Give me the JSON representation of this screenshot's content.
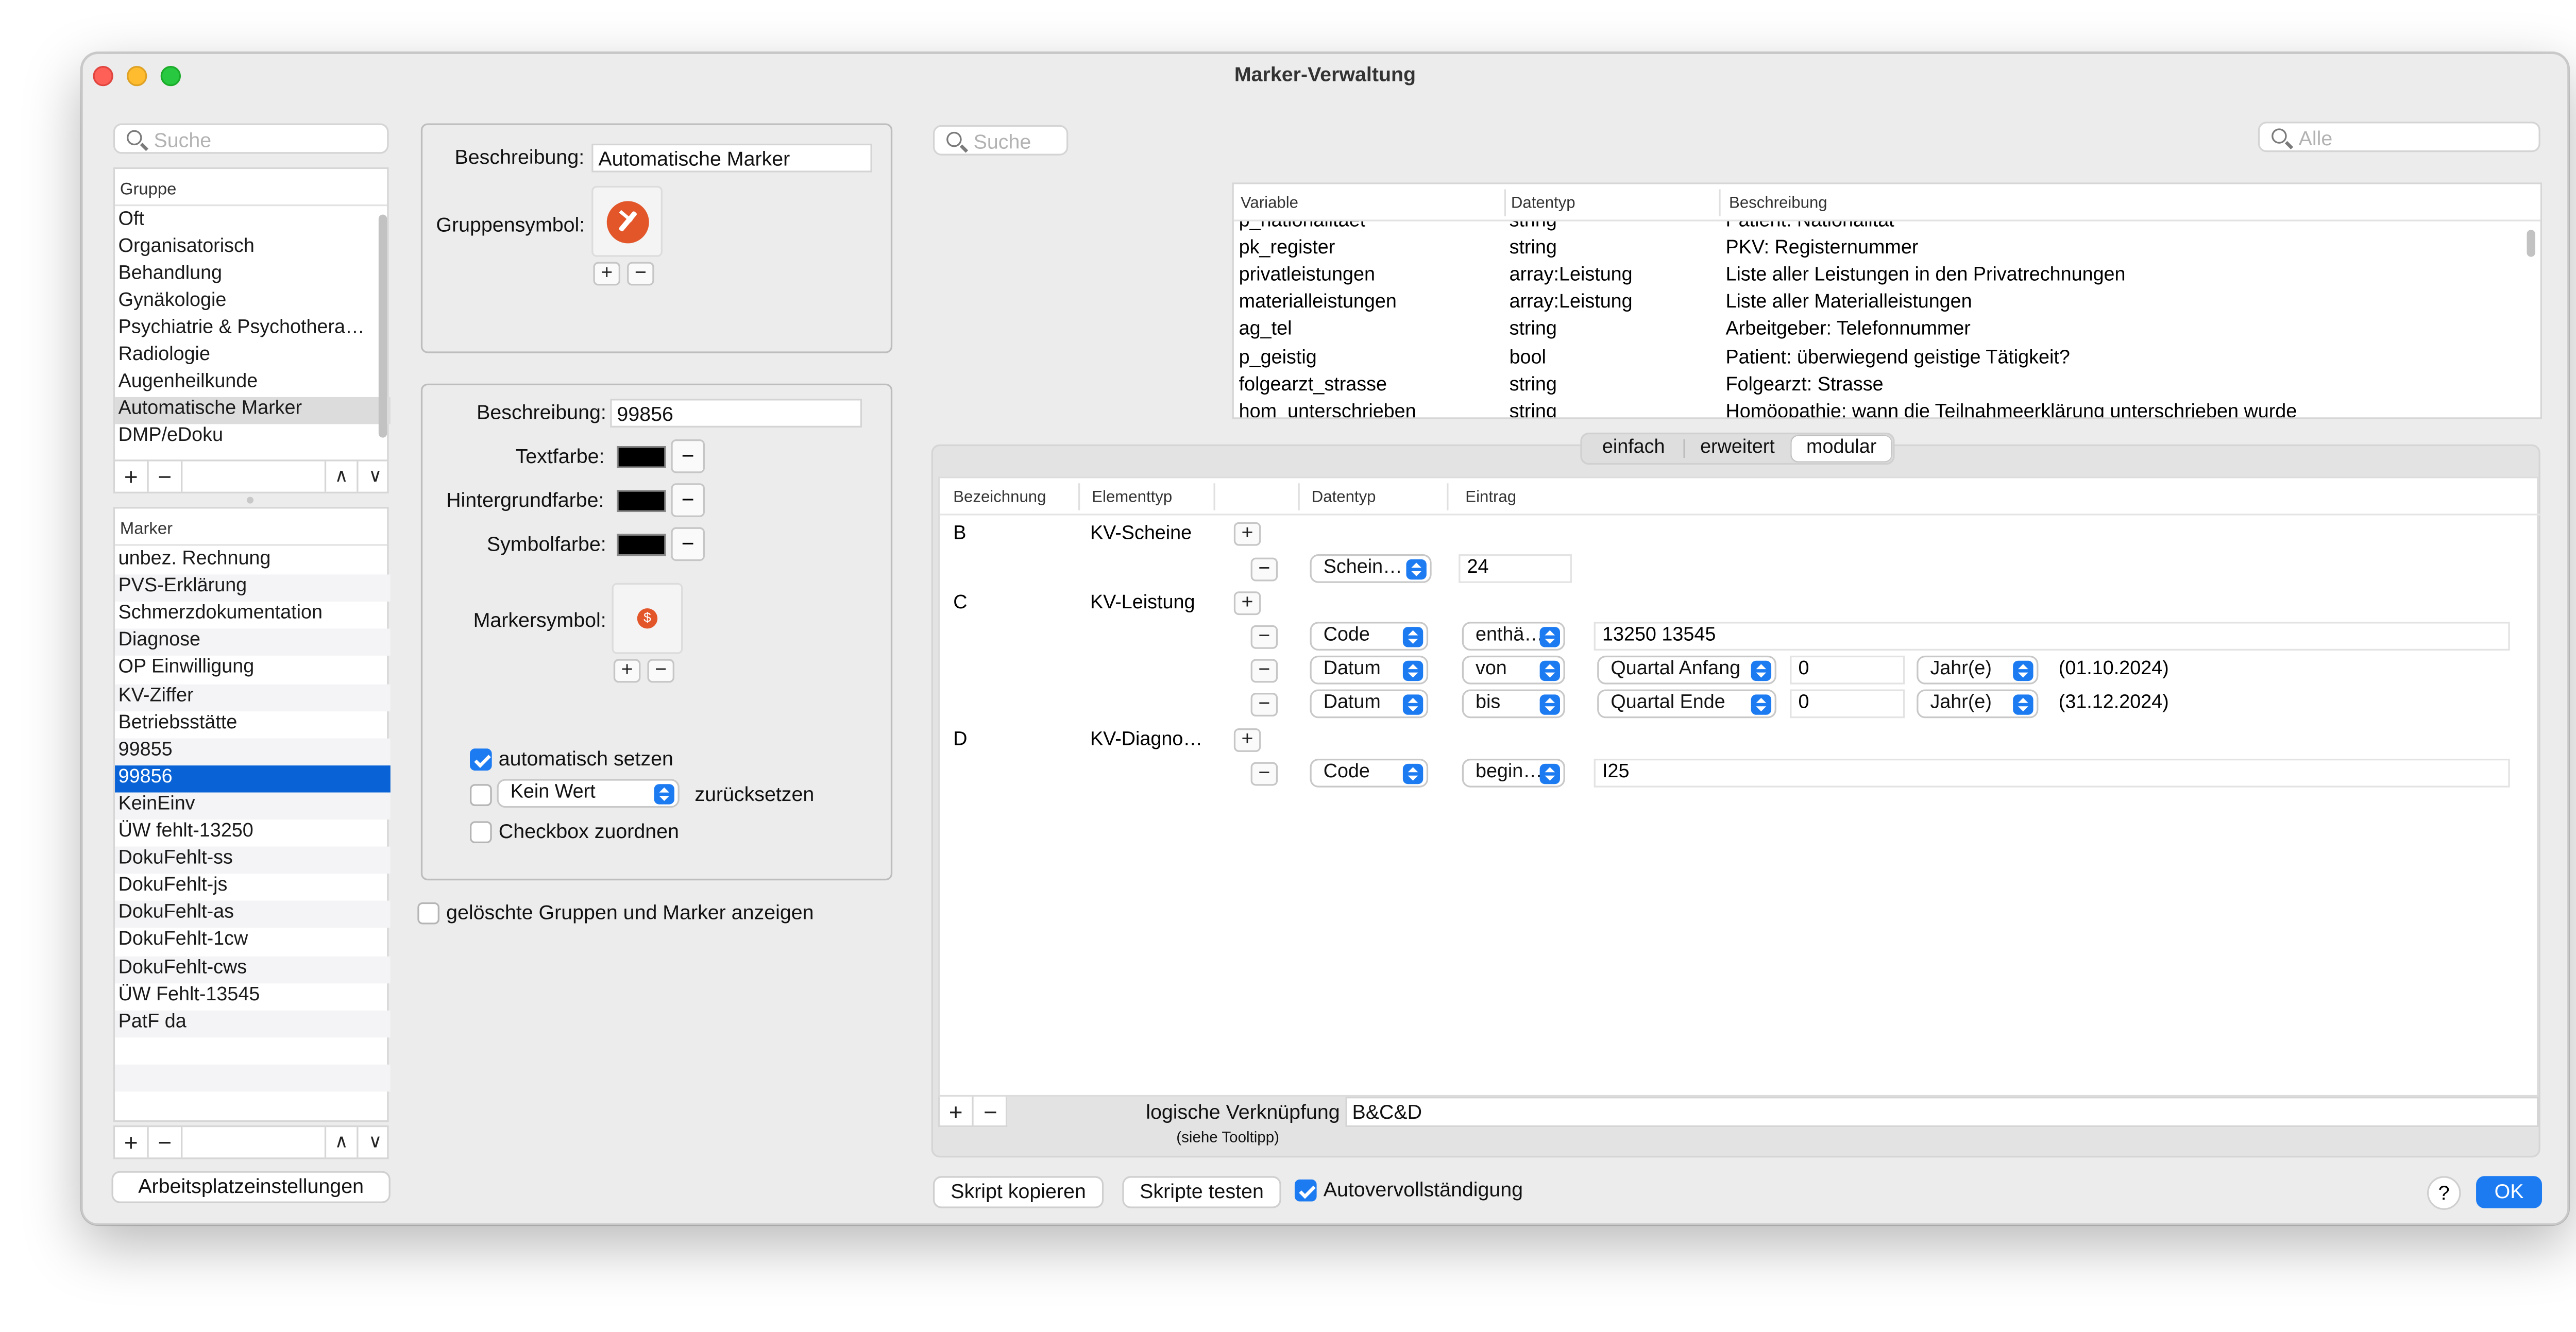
{
  "window": {
    "title": "Marker-Verwaltung"
  },
  "colors": {
    "accent": "#1d7bf2",
    "selection": "#0a63d6",
    "marker_symbol": "#e2562a"
  },
  "left": {
    "search_placeholder": "Suche",
    "group_header": "Gruppe",
    "groups": [
      "Oft",
      "Organisatorisch",
      "Behandlung",
      "Gynäkologie",
      "Psychiatrie & Psychothera…",
      "Radiologie",
      "Augenheilkunde",
      "Automatische Marker",
      "DMP/eDoku"
    ],
    "selected_group": "Automatische Marker",
    "marker_header": "Marker",
    "markers": [
      "unbez. Rechnung",
      "PVS-Erklärung",
      "Schmerzdokumentation",
      "Diagnose",
      "OP Einwilligung",
      "KV-Ziffer",
      "Betriebsstätte",
      "99855",
      "99856",
      "KeinEinv",
      "ÜW fehlt-13250",
      "DokuFehlt-ss",
      "DokuFehlt-js",
      "DokuFehlt-as",
      "DokuFehlt-1cw",
      "DokuFehlt-cws",
      "ÜW Fehlt-13545",
      "PatF da"
    ],
    "selected_marker": "99856",
    "plus": "+",
    "minus": "−",
    "up": "∧",
    "down": "∨",
    "settings_button": "Arbeitsplatzeinstellungen"
  },
  "group_panel": {
    "desc_label": "Beschreibung:",
    "desc_value": "Automatische Marker",
    "symbol_label": "Gruppensymbol:",
    "symbol_icon": "syringe-icon"
  },
  "marker_panel": {
    "desc_label": "Beschreibung:",
    "desc_value": "99856",
    "text_color_label": "Textfarbe:",
    "bg_color_label": "Hintergrundfarbe:",
    "symbol_color_label": "Symbolfarbe:",
    "color_value": "#000000",
    "marker_symbol_label": "Markersymbol:",
    "marker_symbol_icon": "dollar-icon",
    "auto_set_label": "automatisch setzen",
    "auto_set_checked": true,
    "reset_popup": "Kein Wert",
    "reset_label": "zurücksetzen",
    "reset_checked": false,
    "assign_label": "Checkbox zuordnen",
    "assign_checked": false
  },
  "show_deleted_label": "gelöschte Gruppen und Marker anzeigen",
  "right": {
    "search_placeholder": "Suche",
    "filter_placeholder": "Alle",
    "var_table": {
      "headers": [
        "Variable",
        "Datentyp",
        "Beschreibung"
      ],
      "rows": [
        [
          "p_nationalitaet",
          "string",
          "Patient: Nationalität"
        ],
        [
          "pk_register",
          "string",
          "PKV: Registernummer"
        ],
        [
          "privatleistungen",
          "array:Leistung",
          "Liste aller Leistungen in den Privatrechnungen"
        ],
        [
          "materialleistungen",
          "array:Leistung",
          "Liste aller Materialleistungen"
        ],
        [
          "ag_tel",
          "string",
          "Arbeitgeber: Telefonnummer"
        ],
        [
          "p_geistig",
          "bool",
          "Patient: überwiegend geistige Tätigkeit?"
        ],
        [
          "folgearzt_strasse",
          "string",
          "Folgearzt: Strasse"
        ],
        [
          "hom_unterschrieben",
          "string",
          "Homöopathie: wann die Teilnahmeerklärung unterschrieben wurde"
        ]
      ]
    },
    "tabs": [
      "einfach",
      "erweitert",
      "modular"
    ],
    "active_tab": "modular",
    "cond_headers": [
      "Bezeichnung",
      "Elementtyp",
      "Datentyp",
      "Eintrag"
    ],
    "conditions": {
      "B": {
        "label": "B",
        "type": "KV-Scheine",
        "row1": {
          "dtype": "Schein…",
          "value": "24"
        }
      },
      "C": {
        "label": "C",
        "type": "KV-Leistung",
        "row1": {
          "dtype": "Code",
          "op": "enthä…",
          "value": "13250 13545"
        },
        "row2": {
          "dtype": "Datum",
          "op": "von",
          "ref": "Quartal Anfang",
          "num": "0",
          "unit": "Jahr(e)",
          "result": "(01.10.2024)"
        },
        "row3": {
          "dtype": "Datum",
          "op": "bis",
          "ref": "Quartal Ende",
          "num": "0",
          "unit": "Jahr(e)",
          "result": "(31.12.2024)"
        }
      },
      "D": {
        "label": "D",
        "type": "KV-Diagno…",
        "row1": {
          "dtype": "Code",
          "op": "begin…",
          "value": "I25"
        }
      }
    },
    "logic_label": "logische Verknüpfung",
    "logic_hint": "(siehe Tooltipp)",
    "logic_value": "B&C&D",
    "copy_button": "Skript kopieren",
    "test_button": "Skripte testen",
    "autocomplete_label": "Autovervollständigung",
    "autocomplete_checked": true,
    "help": "?",
    "ok": "OK"
  }
}
